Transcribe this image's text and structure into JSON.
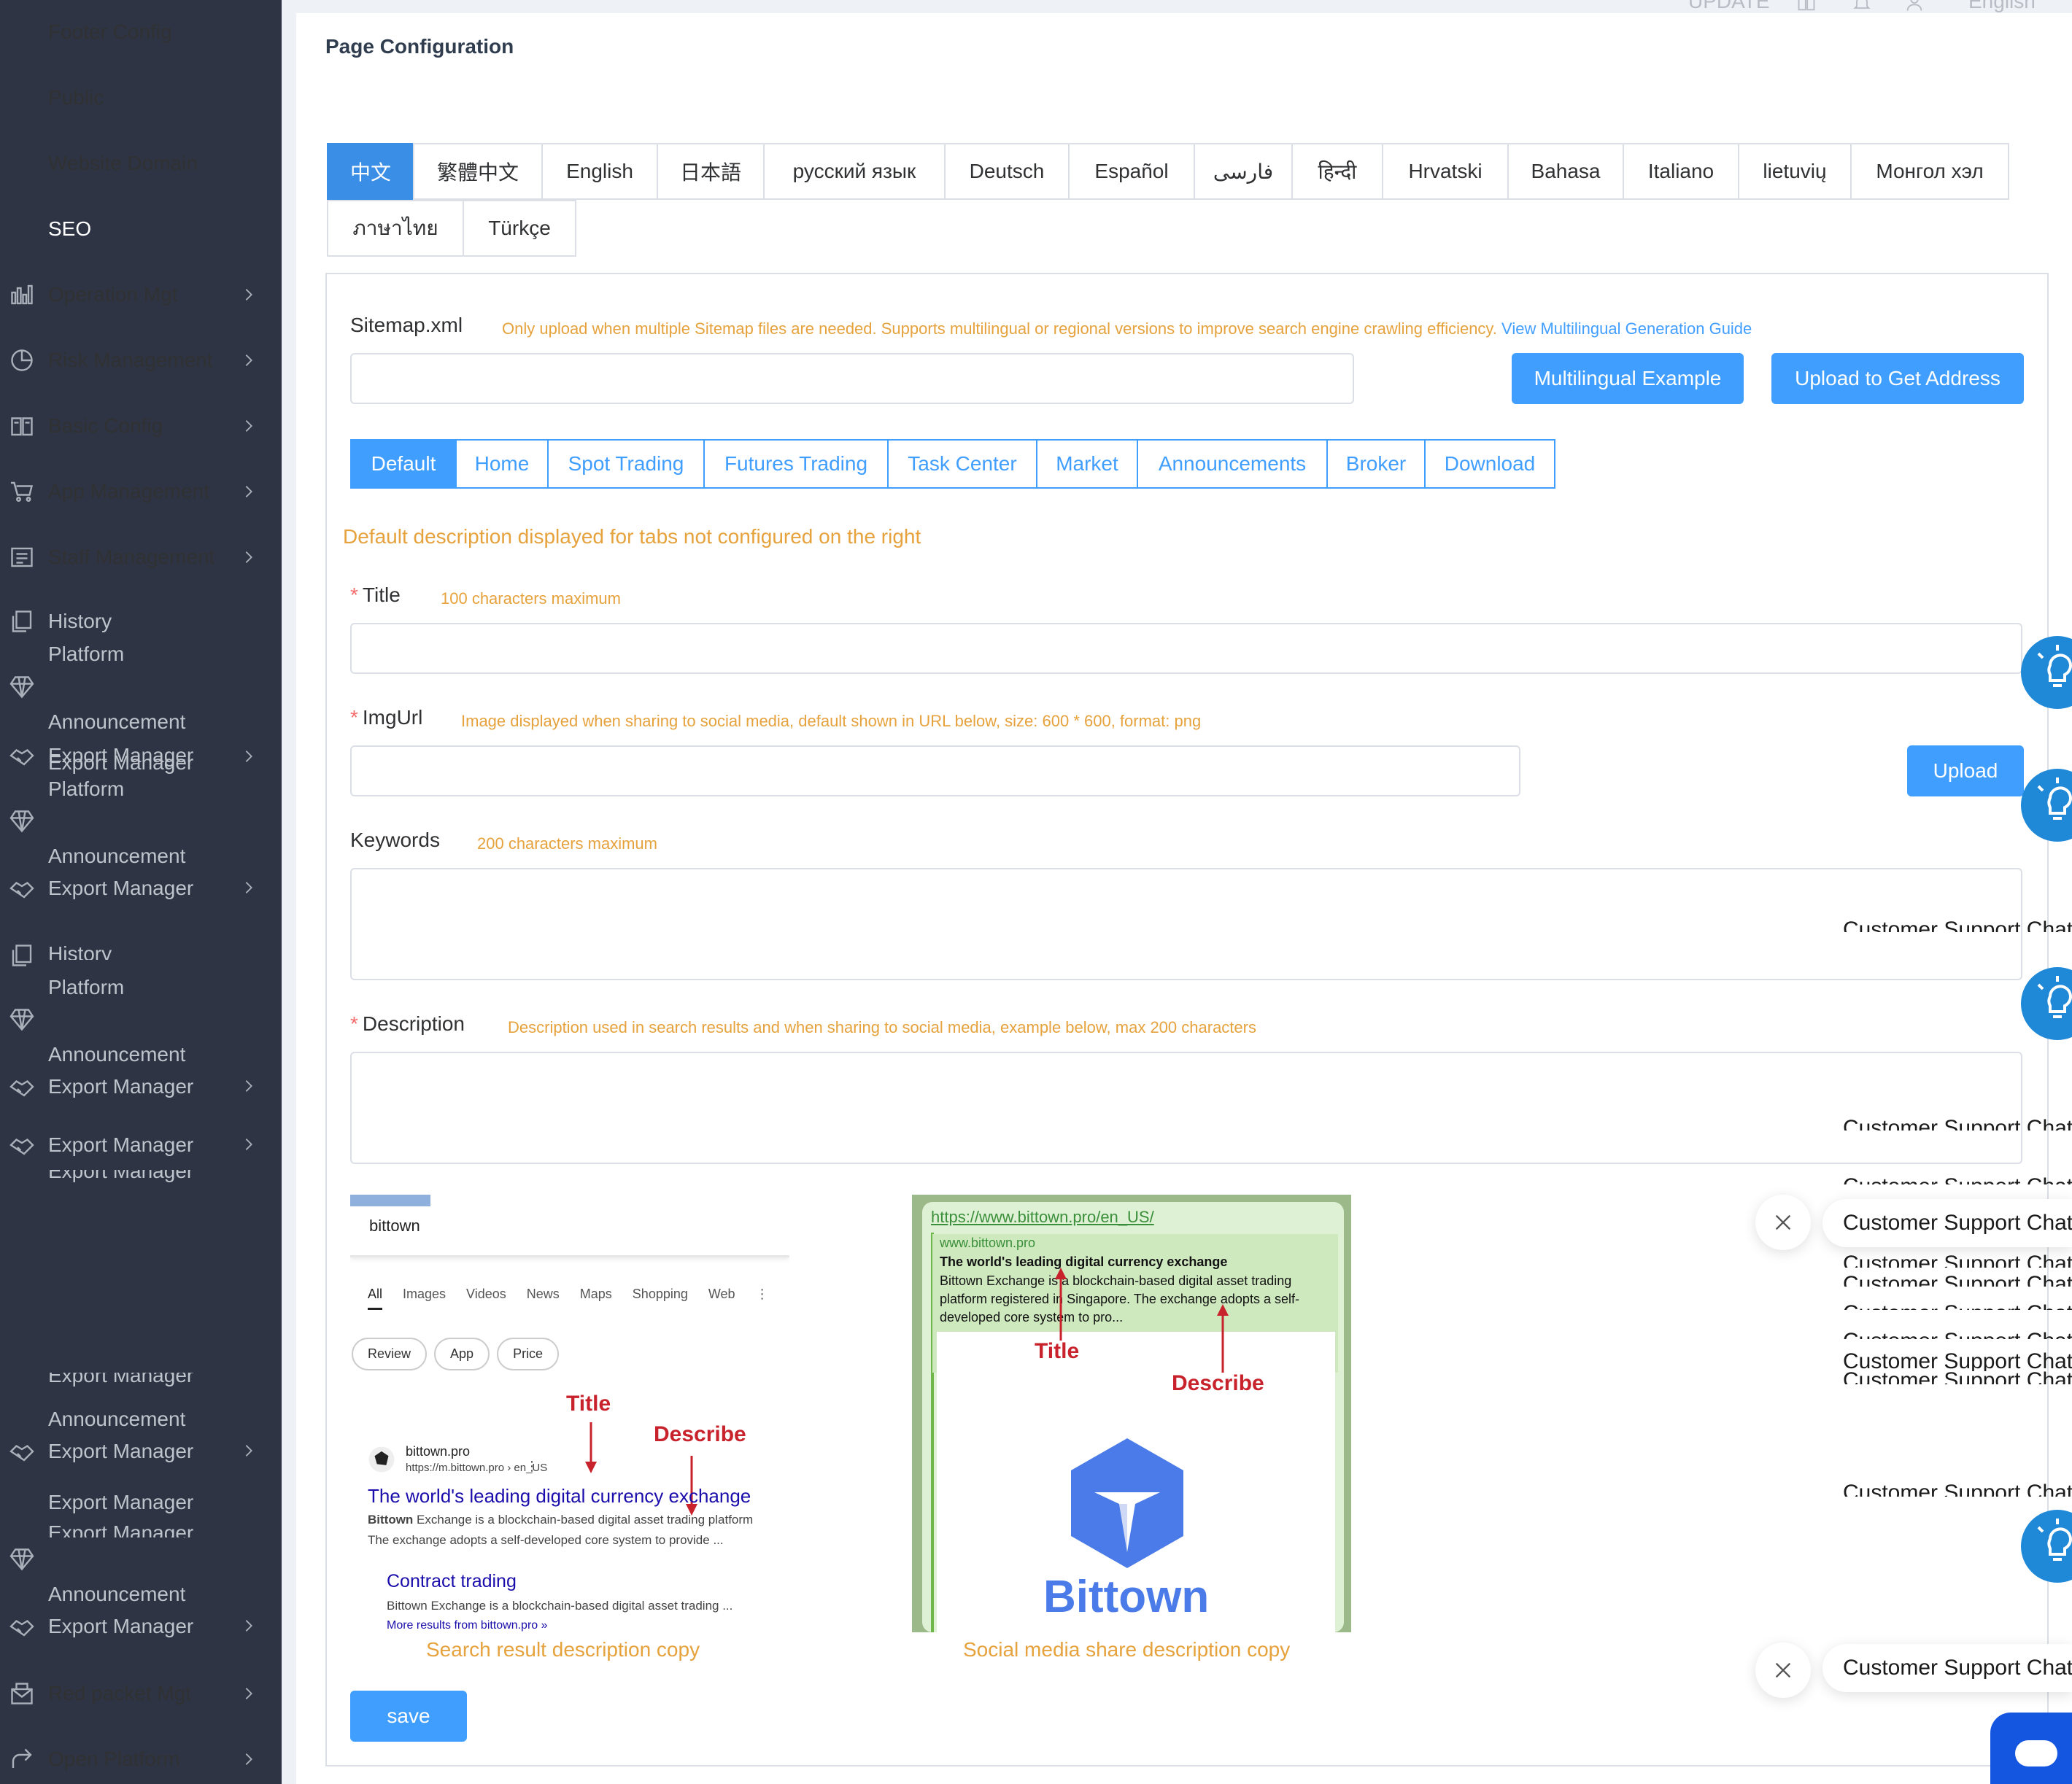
{
  "sidebar": {
    "items": [
      {
        "label": "Footer Config",
        "icon": "none"
      },
      {
        "label": "Public",
        "icon": "none"
      },
      {
        "label": "Website Domain",
        "icon": "none"
      },
      {
        "label": "SEO",
        "icon": "none",
        "active": true
      },
      {
        "label": "Operation Mgt",
        "icon": "bar-chart-icon"
      },
      {
        "label": "Risk Management",
        "icon": "pie-chart-icon"
      },
      {
        "label": "Basic Config",
        "icon": "book-icon"
      },
      {
        "label": "App Management",
        "icon": "cart-icon"
      },
      {
        "label": "Staff Management",
        "icon": "staff-list-icon"
      },
      {
        "label": "History",
        "icon": "copy-icon"
      },
      {
        "label": "Platform",
        "icon": "none"
      },
      {
        "label": "Announcement",
        "icon": "diamond-icon"
      },
      {
        "label": "Export Manager",
        "icon": "handshake-icon"
      },
      {
        "label": "Export Manager",
        "icon": "none"
      },
      {
        "label": "Platform",
        "icon": "none"
      },
      {
        "label": "Announcement",
        "icon": "diamond-icon"
      },
      {
        "label": "Export Manager",
        "icon": "handshake-icon"
      },
      {
        "label": "History",
        "icon": "copy-icon"
      },
      {
        "label": "Platform",
        "icon": "none"
      },
      {
        "label": "Announcement",
        "icon": "diamond-icon"
      },
      {
        "label": "Export Manager",
        "icon": "handshake-icon"
      },
      {
        "label": "Export Manager",
        "icon": "handshake-icon"
      },
      {
        "label": "Export Manager",
        "icon": "chevron-icon"
      },
      {
        "label": "Export Manager",
        "icon": "chevron-icon"
      },
      {
        "label": "Announcement",
        "icon": "none"
      },
      {
        "label": "Export Manager",
        "icon": "handshake-icon"
      },
      {
        "label": "Export Manager",
        "icon": "chevron-icon"
      },
      {
        "label": "Export Manager",
        "icon": "handshake-icon"
      },
      {
        "label": "Announcement",
        "icon": "diamond-icon"
      },
      {
        "label": "Export Manager",
        "icon": "handshake-icon"
      },
      {
        "label": "Red packet Mgt",
        "icon": "envelope-icon"
      },
      {
        "label": "Open Platform",
        "icon": "share-icon"
      }
    ]
  },
  "topbar": {
    "update_label": "UPDATE",
    "language_label": "English",
    "icons": [
      "book-icon",
      "bell-icon",
      "user-icon"
    ]
  },
  "page": {
    "title": "Page Configuration"
  },
  "languages": [
    "中文",
    "繁體中文",
    "English",
    "日本語",
    "русский язык",
    "Deutsch",
    "Español",
    "فارسی",
    "हिन्दी",
    "Hrvatski",
    "Bahasa",
    "Italiano",
    "lietuvių",
    "Монгол хэл",
    "ภาษาไทย",
    "Türkçe"
  ],
  "active_language": "中文",
  "sitemap": {
    "label": "Sitemap.xml",
    "hint": "Only upload when multiple Sitemap files are needed. Supports multilingual or regional versions to improve search engine crawling efficiency.",
    "hint_link": "View Multilingual Generation Guide",
    "value": "",
    "example_button": "Multilingual Example",
    "upload_button": "Upload to Get Address"
  },
  "page_tabs": [
    "Default",
    "Home",
    "Spot Trading",
    "Futures Trading",
    "Task Center",
    "Market",
    "Announcements",
    "Broker",
    "Download"
  ],
  "active_page_tab": "Default",
  "default_note": "Default description displayed for tabs not configured on the right",
  "fields": {
    "title": {
      "label": "Title",
      "required": true,
      "hint": "100 characters maximum",
      "value": ""
    },
    "imgurl": {
      "label": "ImgUrl",
      "required": true,
      "hint": "Image displayed when sharing to social media, default shown in URL below, size: 600 * 600, format: png",
      "value": "",
      "button": "Upload"
    },
    "keywords": {
      "label": "Keywords",
      "required": false,
      "hint": "200 characters maximum",
      "value": ""
    },
    "description": {
      "label": "Description",
      "required": true,
      "hint": "Description used in search results and when sharing to social media, example below, max 200 characters",
      "value": ""
    }
  },
  "search_preview": {
    "query": "bittown",
    "tabs": [
      "All",
      "Images",
      "Videos",
      "News",
      "Maps",
      "Shopping",
      "Web"
    ],
    "chips": [
      "Review",
      "App",
      "Price"
    ],
    "site_name": "bittown.pro",
    "site_url": "https://m.bittown.pro › en_US",
    "result_title": "The world's leading digital currency exchange",
    "result_desc_bold": "Bittown",
    "result_desc_1": " Exchange is a blockchain-based digital asset trading platform",
    "result_desc_2": "The exchange adopts a self-developed core system to provide ...",
    "sub_title": "Contract trading",
    "sub_desc": "Bittown Exchange is a blockchain-based digital asset trading ...",
    "more_results": "More results from bittown.pro »",
    "annot_title": "Title",
    "annot_describe": "Describe",
    "caption": "Search result description copy"
  },
  "social_preview": {
    "url": "https://www.bittown.pro/en_US/",
    "site": "www.bittown.pro",
    "title": "The world's leading digital currency exchange",
    "desc": "Bittown Exchange is a blockchain-based digital asset trading platform registered in Singapore. The exchange adopts a self-developed core system to pro...",
    "annot_title": "Title",
    "annot_describe": "Describe",
    "logo_text": "Bittown",
    "caption": "Social media share description copy"
  },
  "save_button": "save",
  "chat_label": "Customer Support Chat",
  "colors": {
    "primary": "#409eff",
    "active_tab": "#3a8ee6",
    "hint": "#e6a23c",
    "sidebar_bg": "#2e3443",
    "required": "#f56c6c",
    "annotation_red": "#c8232c"
  }
}
